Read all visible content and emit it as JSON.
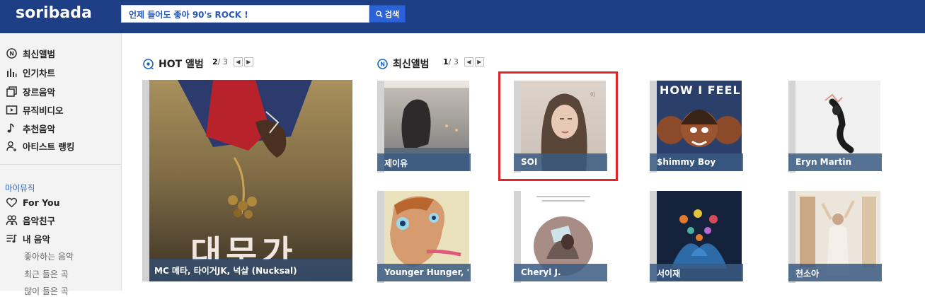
{
  "header": {
    "logo": "soribada",
    "search_value": "언제 들어도 좋아 90's ROCK !",
    "search_button": "검색"
  },
  "sidebar": {
    "items": [
      {
        "label": "최신앨범",
        "icon": "new-album-icon"
      },
      {
        "label": "인기차트",
        "icon": "chart-icon"
      },
      {
        "label": "장르음악",
        "icon": "genre-icon"
      },
      {
        "label": "뮤직비디오",
        "icon": "video-icon"
      },
      {
        "label": "추천음악",
        "icon": "music-note-icon"
      },
      {
        "label": "아티스트 랭킹",
        "icon": "artist-icon"
      }
    ],
    "my_music_heading": "마이뮤직",
    "my_items": [
      {
        "label": "For You",
        "icon": "heart-icon"
      },
      {
        "label": "음악친구",
        "icon": "friends-icon"
      },
      {
        "label": "내 음악",
        "icon": "playlist-icon"
      }
    ],
    "sub_items": [
      "좋아하는 음악",
      "최근 들은 곡",
      "많이 들은 곡"
    ]
  },
  "hot": {
    "title": "HOT 앨범",
    "page_current": "2",
    "page_total": "3",
    "album_label": "MC 메타, 타이거JK, 넉살 (Nucksal)",
    "album_art_text": "대무가"
  },
  "latest": {
    "title": "최신앨범",
    "page_current": "1",
    "page_total": "3",
    "albums": [
      {
        "artist": "제이유"
      },
      {
        "artist": "SOI"
      },
      {
        "artist": "$himmy Boy",
        "art_text": "HOW I FEEL"
      },
      {
        "artist": "Eryn Martin"
      },
      {
        "artist": "Younger Hunger, '"
      },
      {
        "artist": "Cheryl J."
      },
      {
        "artist": "서이재"
      },
      {
        "artist": "천소아"
      }
    ]
  },
  "colors": {
    "header_bg": "#1e3e86",
    "search_button_bg": "#2c62d8",
    "highlight_border": "#e0262a",
    "sidebar_bg": "#f3f3f3"
  }
}
